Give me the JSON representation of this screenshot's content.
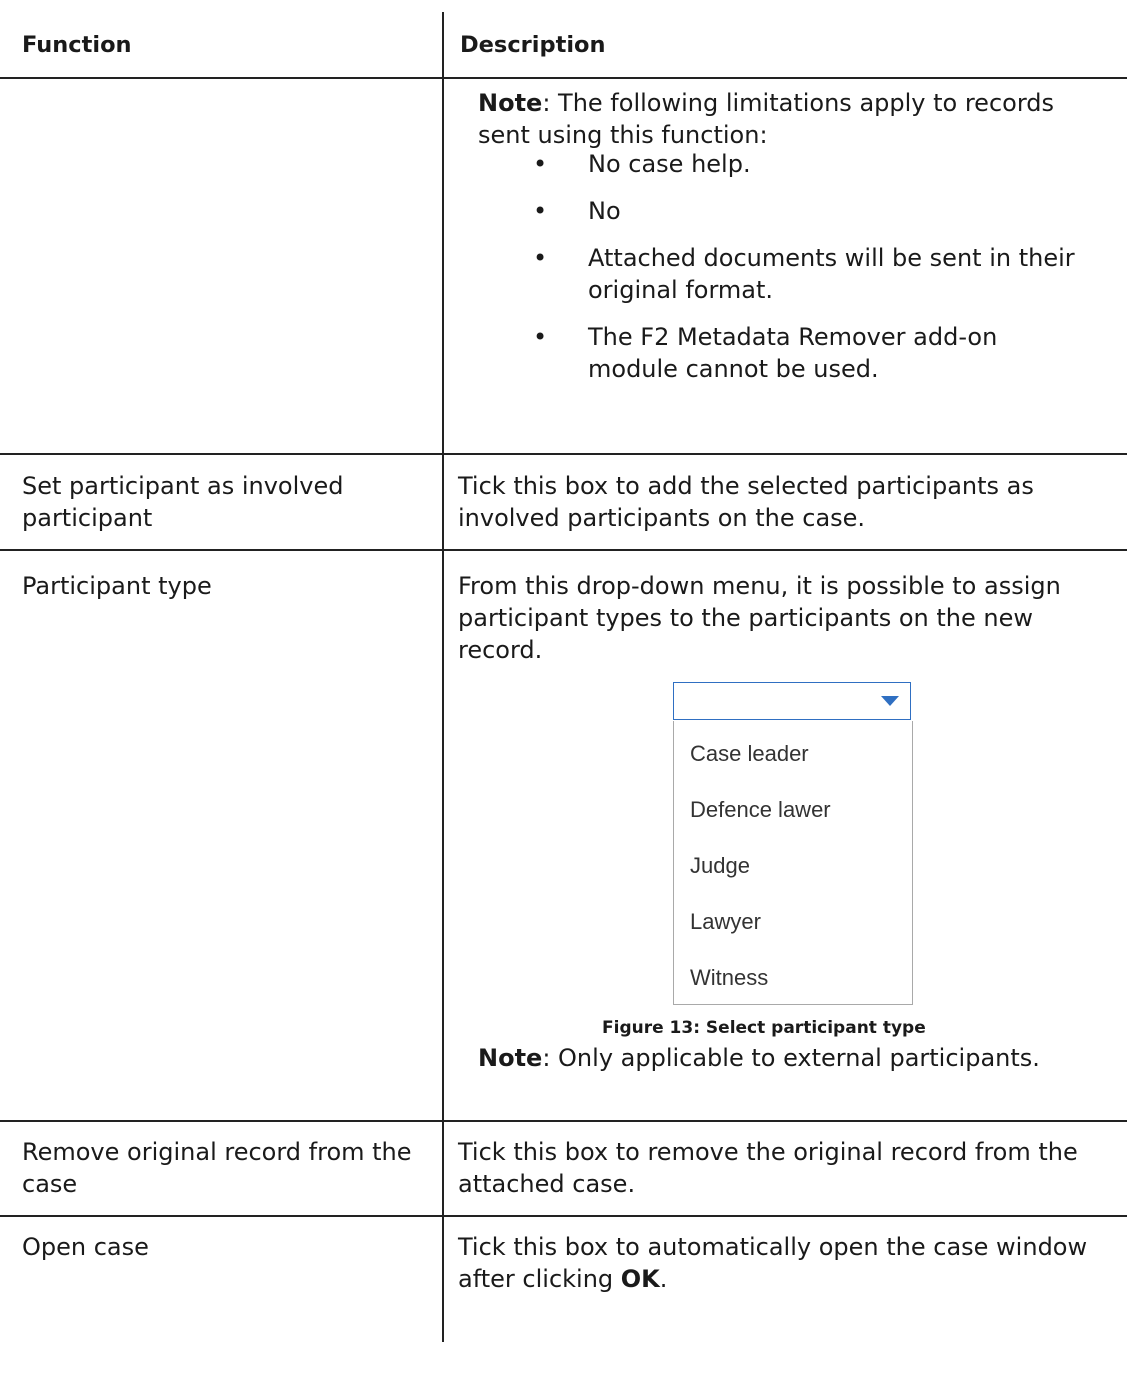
{
  "table": {
    "headers": {
      "function": "Function",
      "description": "Description"
    },
    "row1": {
      "note_label": "Note",
      "note_text": ": The following limitations apply to records sent using this function:",
      "bullets": [
        "No case help.",
        "No",
        "Attached documents will be sent in their original format.",
        "The F2 Metadata Remover add-on module cannot be used."
      ]
    },
    "row2": {
      "function": "Set participant as involved participant",
      "description": "Tick this box to add the selected participants as involved participants on the case."
    },
    "row3": {
      "function": "Participant type",
      "description": "From this drop-down menu, it is possible to assign participant types to the participants on the new record.",
      "dropdown_options": [
        "Case leader",
        "Defence lawer",
        "Judge",
        "Lawyer",
        "Witness"
      ],
      "figure_caption": "Figure 13: Select participant type",
      "note_label": "Note",
      "note_text": ": Only applicable to external participants."
    },
    "row4": {
      "function": "Remove original record from the case",
      "description": "Tick this box to remove the original record from the attached case."
    },
    "row5": {
      "function": "Open case",
      "description_pre": "Tick this box to automatically open the case window after clicking ",
      "description_bold": "OK",
      "description_post": "."
    }
  },
  "colors": {
    "rule": "#222222",
    "dropdown_accent": "#2f6fc2",
    "list_border": "#a9a9a9"
  },
  "icons": {
    "dropdown_arrow": "chevron-down-icon"
  }
}
